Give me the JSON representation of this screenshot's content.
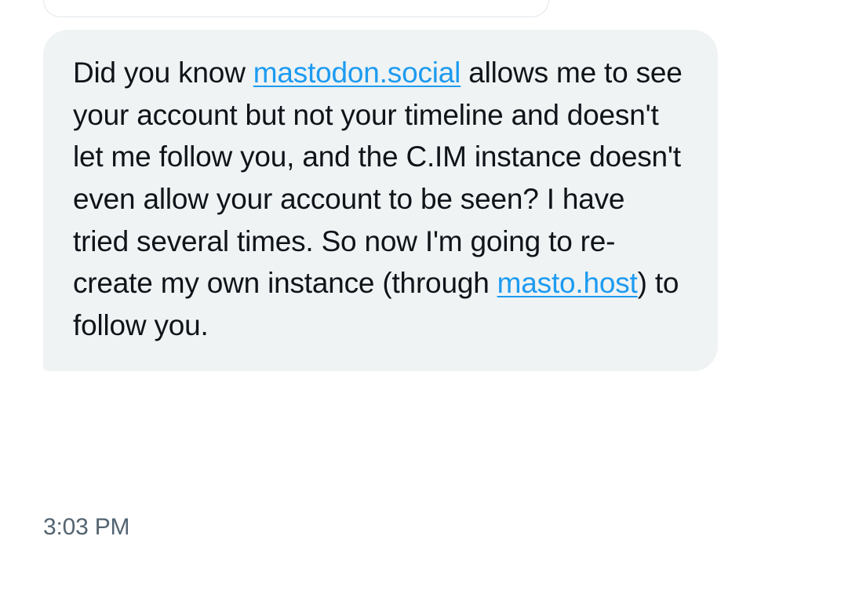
{
  "message": {
    "text_part1": "Did you know ",
    "link1_text": "mastodon.social",
    "text_part2": " allows me to see your account but not your timeline and doesn't let me follow you, and the C.IM instance doesn't even allow your account to be seen? I have tried several times. So now I'm going to re-create my own instance (through ",
    "link2_text": "masto.host",
    "text_part3": ") to follow you."
  },
  "timestamp": "3:03 PM"
}
